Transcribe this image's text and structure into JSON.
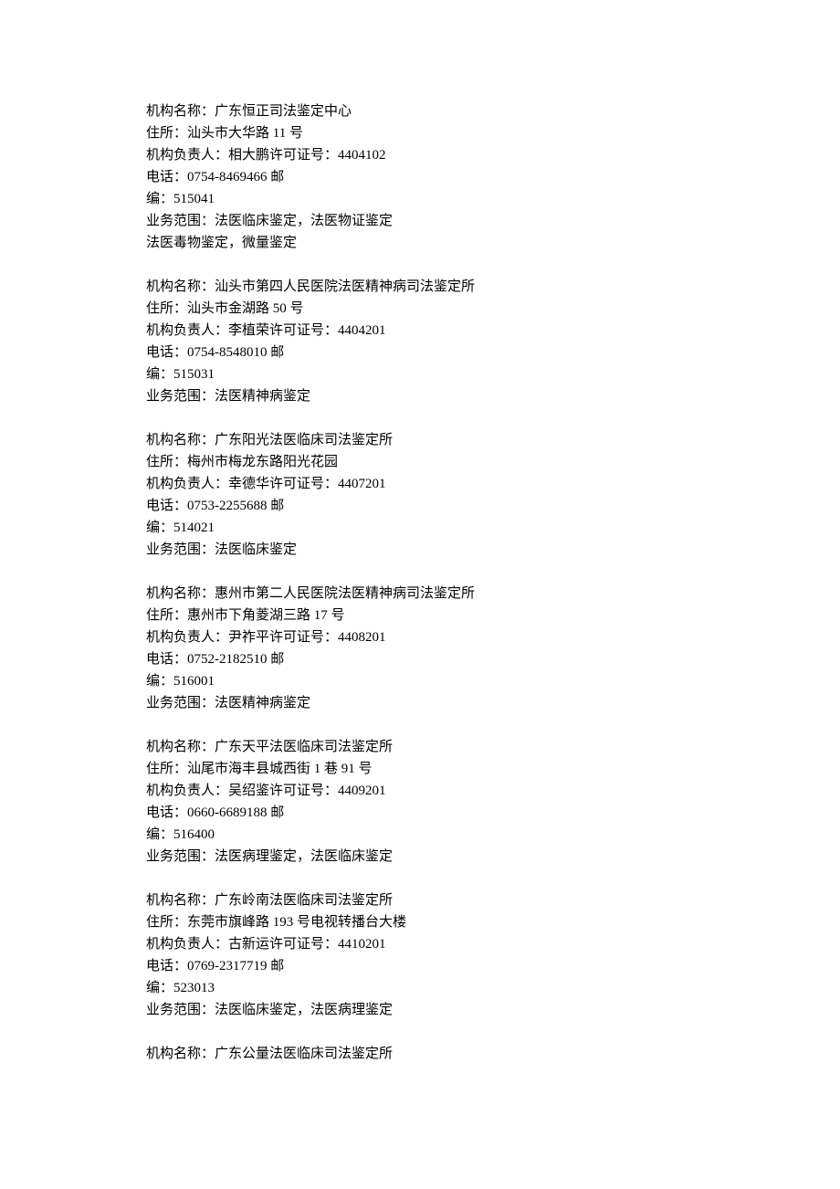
{
  "labels": {
    "org_name": "机构名称：",
    "address": "住所：",
    "manager": "机构负责人：",
    "permit_no_label": "许可证号：",
    "phone": "电话：",
    "mail_suffix": " 邮",
    "postcode_prefix": "编：",
    "scope": "业务范围："
  },
  "entries": [
    {
      "name": "广东恒正司法鉴定中心",
      "address": "汕头市大华路 11 号",
      "manager": "相大鹏",
      "permit": "4404102",
      "phone": "0754-8469466",
      "postcode": "515041",
      "scope_lines": [
        "法医临床鉴定，法医物证鉴定",
        "法医毒物鉴定，微量鉴定"
      ]
    },
    {
      "name": "汕头市第四人民医院法医精神病司法鉴定所",
      "address": "汕头市金湖路 50 号",
      "manager": "李植荣",
      "permit": "4404201",
      "phone": "0754-8548010",
      "postcode": "515031",
      "scope_lines": [
        "法医精神病鉴定"
      ]
    },
    {
      "name": "广东阳光法医临床司法鉴定所",
      "address": "梅州市梅龙东路阳光花园",
      "manager": "幸德华",
      "permit": "4407201",
      "phone": "0753-2255688",
      "postcode": "514021",
      "scope_lines": [
        "法医临床鉴定"
      ]
    },
    {
      "name": "惠州市第二人民医院法医精神病司法鉴定所",
      "address": "惠州市下角菱湖三路 17 号",
      "manager": "尹祚平",
      "permit": "4408201",
      "phone": "0752-2182510",
      "postcode": "516001",
      "scope_lines": [
        "法医精神病鉴定"
      ]
    },
    {
      "name": "广东天平法医临床司法鉴定所",
      "address": "汕尾市海丰县城西街 1 巷 91 号",
      "manager": "吴绍鉴",
      "permit": "4409201",
      "phone": "0660-6689188",
      "postcode": "516400",
      "scope_lines": [
        "法医病理鉴定，法医临床鉴定"
      ]
    },
    {
      "name": "广东岭南法医临床司法鉴定所",
      "address": "东莞市旗峰路 193 号电视转播台大楼",
      "manager": "古新运",
      "permit": "4410201",
      "phone": "0769-2317719",
      "postcode": "523013",
      "scope_lines": [
        "法医临床鉴定，法医病理鉴定"
      ]
    },
    {
      "name": "广东公量法医临床司法鉴定所",
      "partial": true
    }
  ]
}
